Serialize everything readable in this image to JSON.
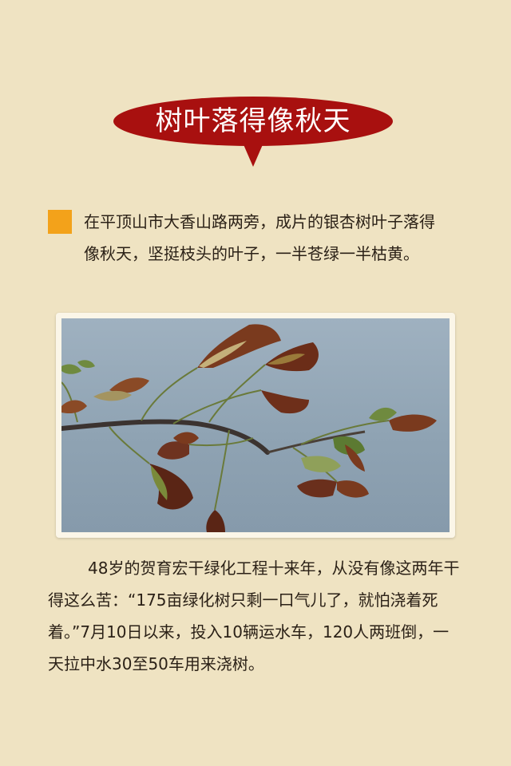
{
  "title": "树叶落得像秋天",
  "intro": {
    "text": "在平顶山市大香山路两旁，成片的银杏树叶子落得像秋天，坚挺枝头的叶子，一半苍绿一半枯黄。"
  },
  "photo": {
    "icon": "ginkgo-branch-photo"
  },
  "body": {
    "text": "48岁的贺育宏干绿化工程十来年，从没有像这两年干得这么苦：“175亩绿化树只剩一口气儿了，就怕浇着死着。”7月10日以来，投入10辆运水车，120人两班倒，一天拉中水30至50车用来浇树。"
  },
  "colors": {
    "background": "#efe3c2",
    "banner": "#a8100f",
    "bullet": "#f3a21a",
    "text": "#2b2117"
  }
}
